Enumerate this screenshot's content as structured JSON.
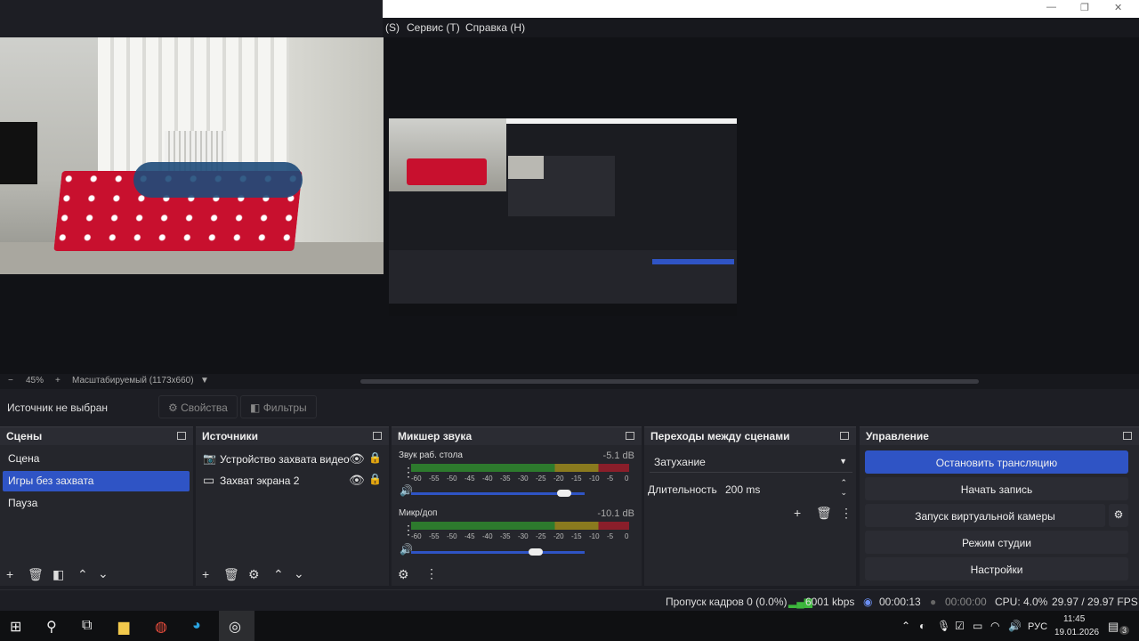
{
  "menubar": {
    "items": [
      "(S)",
      "Сервис (T)",
      "Справка (H)"
    ]
  },
  "preview": {
    "zoom": "45%",
    "scale_mode": "Масштабируемый (1173x660)"
  },
  "source_bar": {
    "status": "Источник не выбран",
    "properties": "Свойства",
    "filters": "Фильтры"
  },
  "scenes": {
    "title": "Сцены",
    "items": [
      "Сцена",
      "Игры без захвата",
      "Пауза"
    ],
    "selected_index": 1
  },
  "sources": {
    "title": "Источники",
    "items": [
      "Устройство захвата видео",
      "Захват экрана 2"
    ]
  },
  "mixer": {
    "title": "Микшер звука",
    "channels": [
      {
        "name": "Звук раб. стола",
        "level": "-5.1 dB",
        "volume": 0.88
      },
      {
        "name": "Микр/доп",
        "level": "-10.1 dB",
        "volume": 0.72
      }
    ],
    "ticks": [
      "-60",
      "-55",
      "-50",
      "-45",
      "-40",
      "-35",
      "-30",
      "-25",
      "-20",
      "-15",
      "-10",
      "-5",
      "0"
    ]
  },
  "transitions": {
    "title": "Переходы между сценами",
    "selected": "Затухание",
    "duration_label": "Длительность",
    "duration_value": "200 ms"
  },
  "controls": {
    "title": "Управление",
    "stop_stream": "Остановить трансляцию",
    "start_record": "Начать запись",
    "virtual_cam": "Запуск виртуальной камеры",
    "studio_mode": "Режим студии",
    "settings": "Настройки"
  },
  "status": {
    "dropped": "Пропуск кадров 0 (0.0%)",
    "bitrate": "6001 kbps",
    "stream_time": "00:00:13",
    "record_time": "00:00:00",
    "cpu": "CPU: 4.0%",
    "fps": "29.97 / 29.97 FPS"
  },
  "taskbar": {
    "lang": "РУС",
    "time": "11:45",
    "date": "19.01.2026",
    "notif_count": "3"
  },
  "colors": {
    "accent": "#2f54c5",
    "bg": "#1d1e24",
    "panel": "#25262c"
  }
}
